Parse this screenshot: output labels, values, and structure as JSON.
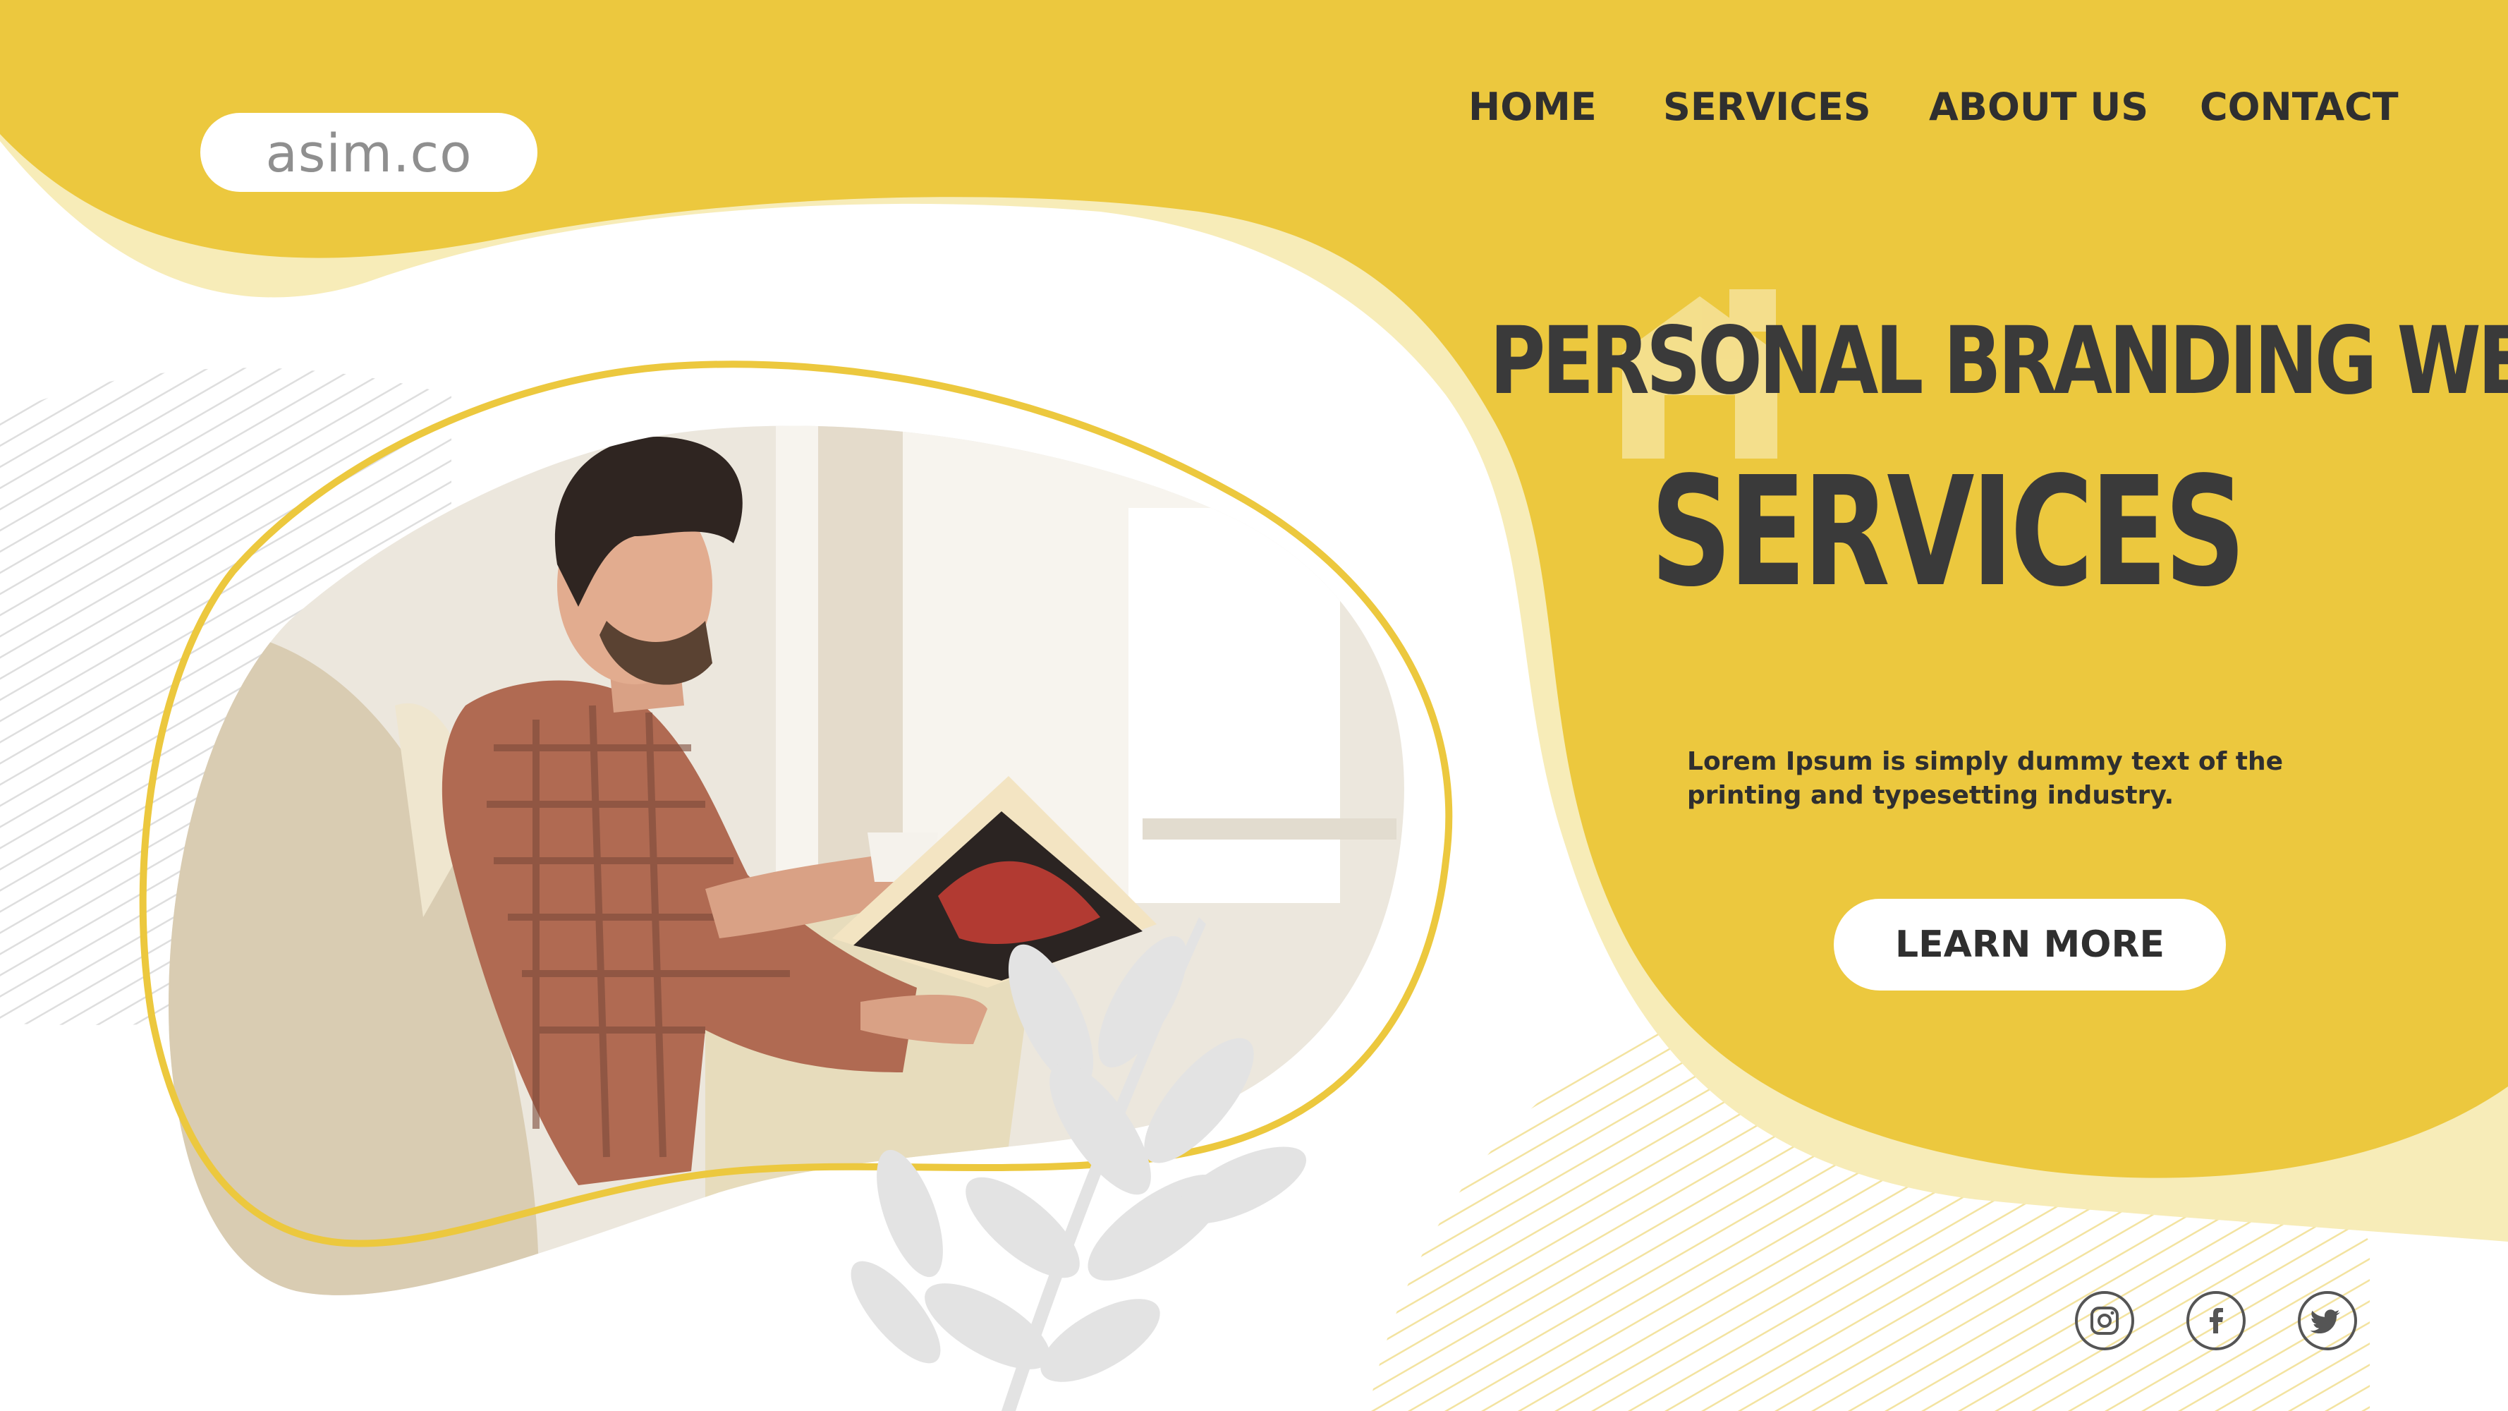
{
  "brand": {
    "logo_text": "asim.co"
  },
  "nav": {
    "items": [
      {
        "label": "HOME"
      },
      {
        "label": "SERVICES"
      },
      {
        "label": "ABOUT US"
      },
      {
        "label": "CONTACT"
      }
    ]
  },
  "hero": {
    "title_line1": "PERSONAL BRANDING WEB",
    "title_line2": "SERVICES",
    "description": "Lorem Ipsum is simply dummy text of the printing and typesetting industry.",
    "cta_label": "LEARN MORE",
    "image": "man-reading-book-photo"
  },
  "social": {
    "icons": [
      "instagram-icon",
      "facebook-icon",
      "twitter-icon"
    ]
  },
  "colors": {
    "accent_yellow": "#ECC83E",
    "light_yellow": "#F7ECB8",
    "text_dark": "#2F2F2F",
    "white": "#FFFFFF"
  }
}
